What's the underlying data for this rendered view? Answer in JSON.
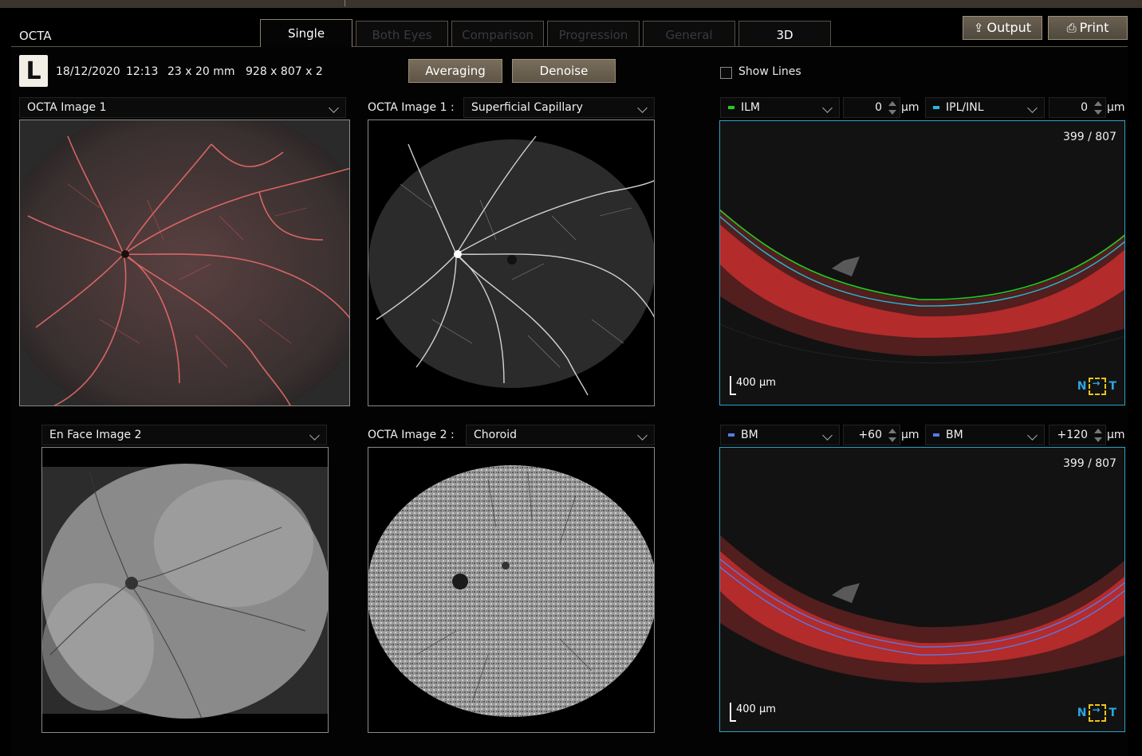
{
  "app": {
    "title": "OCTA"
  },
  "tabs": [
    {
      "label": "Single",
      "state": "active"
    },
    {
      "label": "Both Eyes",
      "state": "disabled"
    },
    {
      "label": "Comparison",
      "state": "disabled"
    },
    {
      "label": "Progression",
      "state": "disabled"
    },
    {
      "label": "General",
      "state": "disabled"
    },
    {
      "label": "3D",
      "state": "enabled"
    }
  ],
  "toolbar": {
    "output_label": "Output",
    "print_label": "Print"
  },
  "scan_info": {
    "eye": "L",
    "date": "18/12/2020",
    "time": "12:13",
    "size": "23 x 20 mm",
    "resolution": "928 x 807 x 2"
  },
  "processing": {
    "averaging_label": "Averaging",
    "denoise_label": "Denoise"
  },
  "show_lines": {
    "label": "Show Lines",
    "checked": false
  },
  "panels": {
    "top_left": {
      "select": "OCTA Image 1"
    },
    "top_middle": {
      "label": "OCTA Image 1 :",
      "select": "Superficial Capillary"
    },
    "bottom_left": {
      "select": "En Face Image 2"
    },
    "bottom_middle": {
      "label": "OCTA Image 2 :",
      "select": "Choroid"
    }
  },
  "bscan_top": {
    "upper_layer": "ILM",
    "upper_color": "#22cc22",
    "upper_offset": "0",
    "lower_layer": "IPL/INL",
    "lower_color": "#22bcd8",
    "lower_offset": "0",
    "unit": "µm",
    "counter": "399 / 807",
    "scale_label": "400 µm"
  },
  "bscan_bottom": {
    "upper_layer": "BM",
    "upper_color": "#5a78e8",
    "upper_offset": "+60",
    "lower_layer": "BM",
    "lower_color": "#5a78e8",
    "lower_offset": "+120",
    "unit": "µm",
    "counter": "399 / 807",
    "scale_label": "400 µm"
  },
  "orientation": {
    "nasal": "N",
    "temporal": "T"
  }
}
